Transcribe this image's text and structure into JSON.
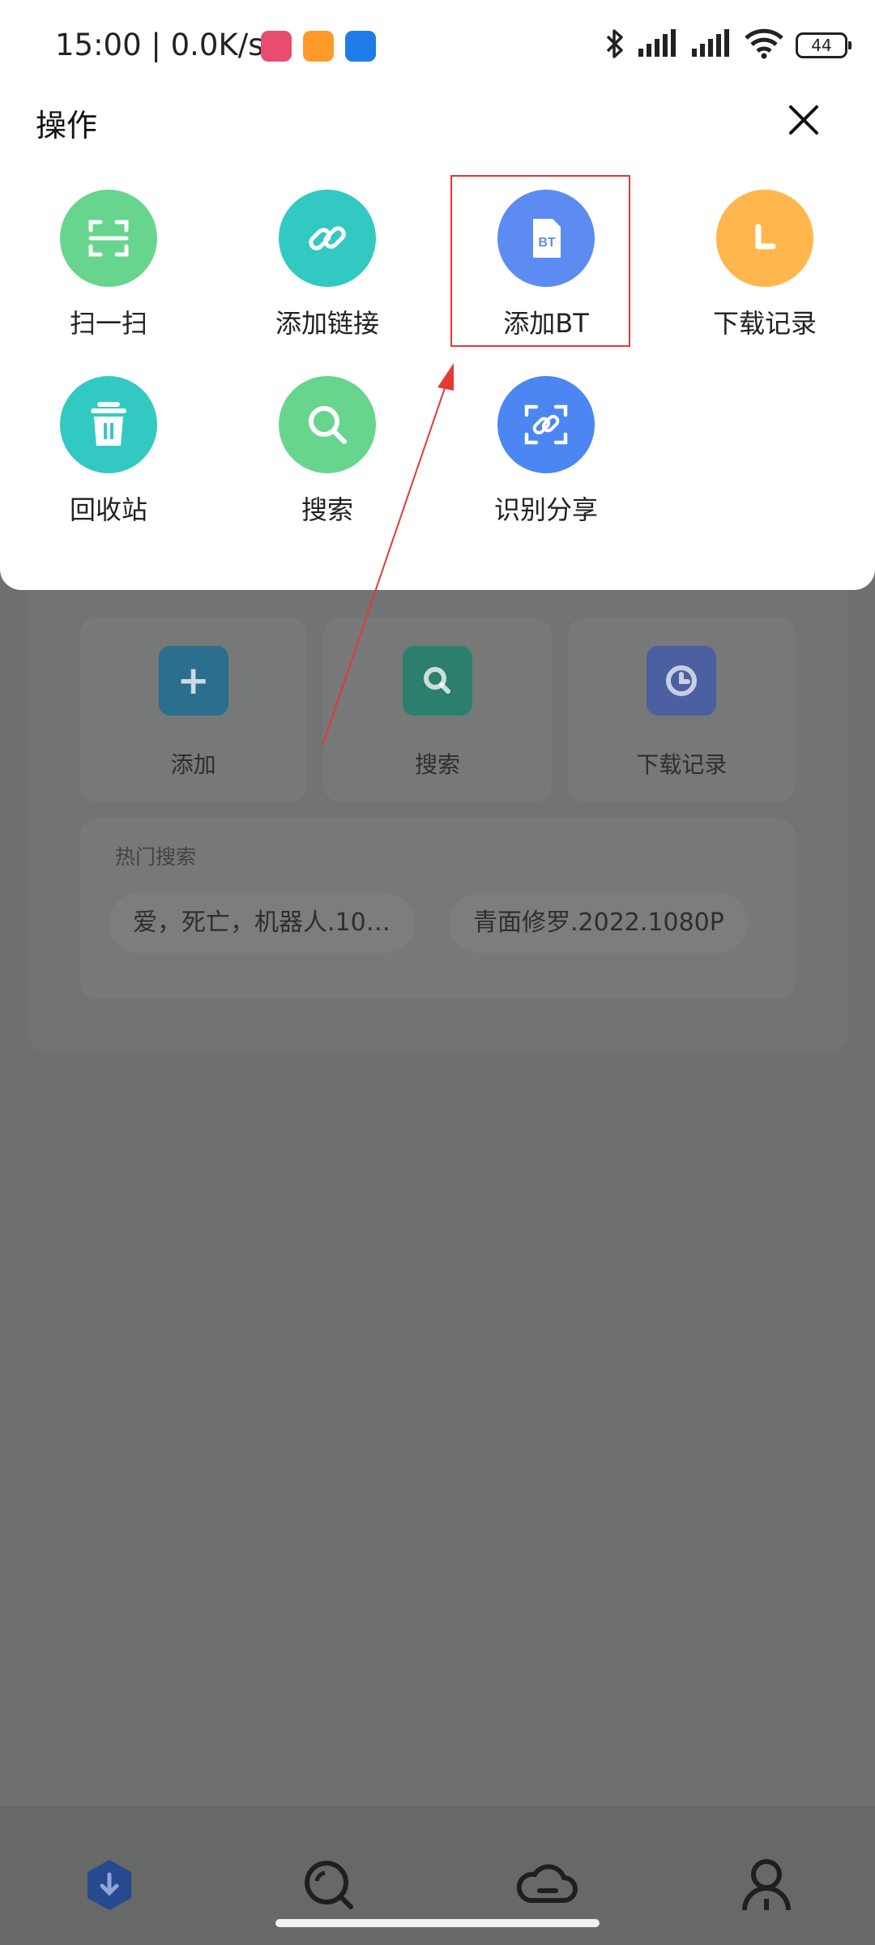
{
  "status_bar": {
    "time": "15:00 | 0.0K/s",
    "battery": "44"
  },
  "sheet": {
    "title": "操作",
    "actions": [
      {
        "label": "扫一扫",
        "icon": "scan-icon",
        "color": "#67D58E"
      },
      {
        "label": "添加链接",
        "icon": "link-icon",
        "color": "#33C9C3"
      },
      {
        "label": "添加BT",
        "icon": "bt-file-icon",
        "color": "#5C8BF2"
      },
      {
        "label": "下载记录",
        "icon": "clock-icon",
        "color": "#FFB74D"
      },
      {
        "label": "回收站",
        "icon": "trash-icon",
        "color": "#33C9C3"
      },
      {
        "label": "搜索",
        "icon": "search-icon",
        "color": "#67D58E"
      },
      {
        "label": "识别分享",
        "icon": "share-link-icon",
        "color": "#4B86F2"
      }
    ]
  },
  "background": {
    "quick_actions": [
      {
        "label": "添加",
        "icon": "plus-icon",
        "color": "#2C6E8E"
      },
      {
        "label": "搜索",
        "icon": "search-icon",
        "color": "#2D7F6D"
      },
      {
        "label": "下载记录",
        "icon": "clock-icon",
        "color": "#4C5FA1"
      }
    ],
    "hot_search_title": "热门搜索",
    "hot_chips": [
      "爱，死亡，机器人.10…",
      "青面修罗.2022.1080P"
    ]
  },
  "annotation_color": "#E53935"
}
